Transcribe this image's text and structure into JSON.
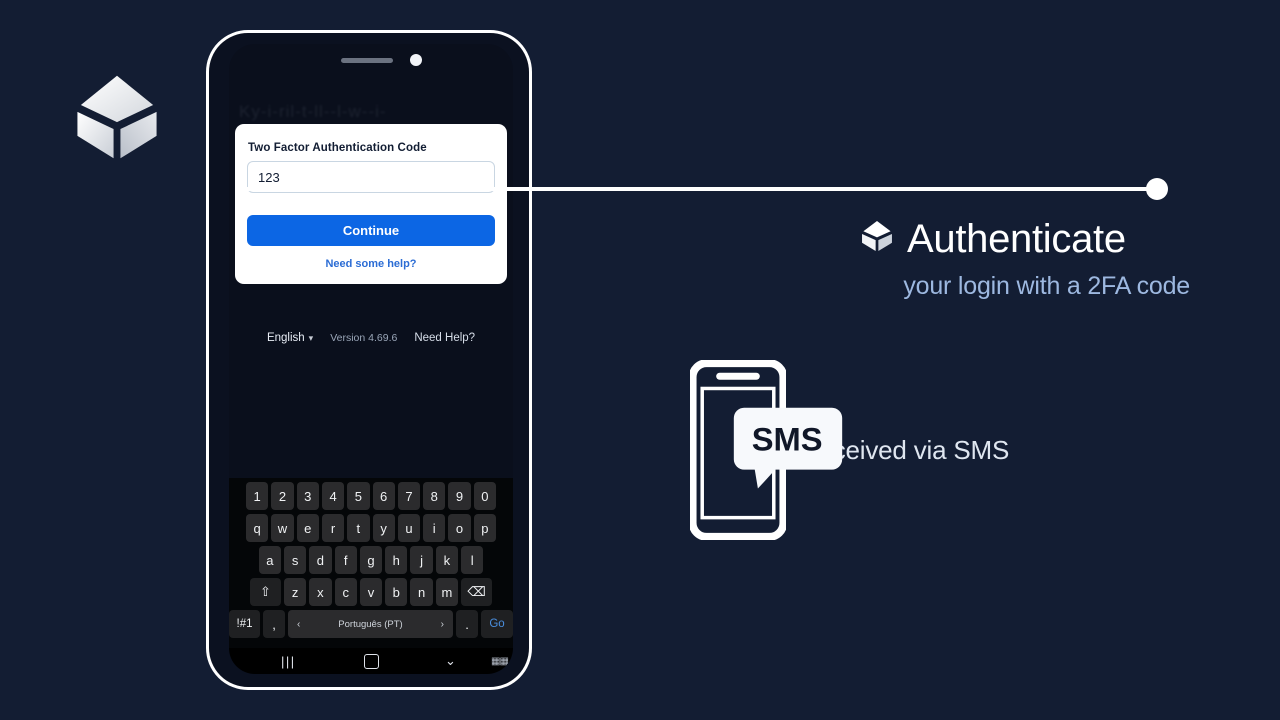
{
  "theme": {
    "background": "#131d33",
    "accent_blue": "#0c66e4",
    "link_blue": "#2b6cd4",
    "subtitle_blue": "#9db8e0",
    "white": "#ffffff"
  },
  "brand": {
    "logo_name": "blockchain-cube-logo"
  },
  "phone": {
    "background_text": "Ky-i-ril-t-ll--l-w--i-",
    "auth_card": {
      "label": "Two Factor Authentication Code",
      "input_value": "123",
      "input_placeholder": "",
      "continue_label": "Continue",
      "help_link": "Need some help?"
    },
    "footer": {
      "language": "English",
      "language_chevron": "chevron-down-icon",
      "version": "Version 4.69.6",
      "help": "Need Help?"
    },
    "keyboard": {
      "row_numbers": [
        "1",
        "2",
        "3",
        "4",
        "5",
        "6",
        "7",
        "8",
        "9",
        "0"
      ],
      "row_top": [
        "q",
        "w",
        "e",
        "r",
        "t",
        "y",
        "u",
        "i",
        "o",
        "p"
      ],
      "row_home": [
        "a",
        "s",
        "d",
        "f",
        "g",
        "h",
        "j",
        "k",
        "l"
      ],
      "row_bottom": [
        "z",
        "x",
        "c",
        "v",
        "b",
        "n",
        "m"
      ],
      "shift_icon": "⇧",
      "backspace_icon": "⌫",
      "symbols_key": "!#1",
      "comma_key": ",",
      "period_key": ".",
      "space_label": "Português (PT)",
      "space_prev_icon": "‹",
      "space_next_icon": "›",
      "go_key": "Go"
    },
    "nav_bar": {
      "recents": "|||",
      "home_icon": "home-square-icon",
      "down_icon": "⌄",
      "keyboard_icon": "keyboard-icon"
    }
  },
  "callout": {
    "headline_icon": "blockchain-cube-icon",
    "headline": "Authenticate",
    "subhead": "your login with a 2FA code"
  },
  "sms": {
    "phone_icon": "sms-phone-icon",
    "bubble_text": "SMS",
    "caption": "received via SMS"
  }
}
